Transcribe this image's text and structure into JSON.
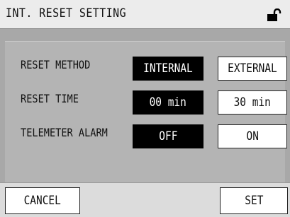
{
  "header": {
    "title": "INT. RESET SETTING",
    "lock_icon": "unlocked-padlock-icon"
  },
  "rows": [
    {
      "label": "RESET METHOD",
      "options": [
        "INTERNAL",
        "EXTERNAL"
      ],
      "selected": "INTERNAL"
    },
    {
      "label": "RESET TIME",
      "options": [
        "00 min",
        "30 min"
      ],
      "selected": "00 min"
    },
    {
      "label": "TELEMETER ALARM",
      "options": [
        "OFF",
        "ON"
      ],
      "selected": "OFF"
    }
  ],
  "footer": {
    "cancel_label": "CANCEL",
    "set_label": "SET"
  },
  "colors": {
    "background": "#a8a8a8",
    "selected": "#000000",
    "unselected": "#ffffff"
  }
}
